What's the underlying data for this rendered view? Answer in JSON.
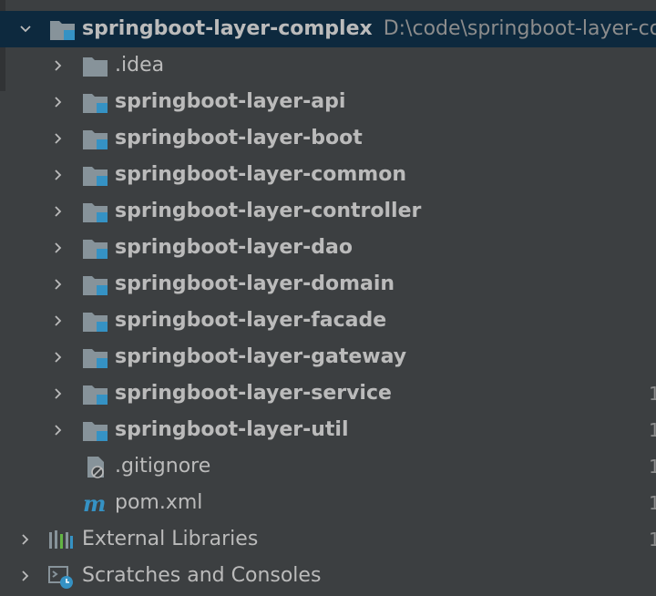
{
  "project": {
    "name": "springboot-layer-complex",
    "path": "D:\\code\\springboot-layer-complex"
  },
  "items": [
    {
      "label": ".idea",
      "kind": "folder"
    },
    {
      "label": "springboot-layer-api",
      "kind": "module"
    },
    {
      "label": "springboot-layer-boot",
      "kind": "module"
    },
    {
      "label": "springboot-layer-common",
      "kind": "module"
    },
    {
      "label": "springboot-layer-controller",
      "kind": "module"
    },
    {
      "label": "springboot-layer-dao",
      "kind": "module"
    },
    {
      "label": "springboot-layer-domain",
      "kind": "module"
    },
    {
      "label": "springboot-layer-facade",
      "kind": "module"
    },
    {
      "label": "springboot-layer-gateway",
      "kind": "module"
    },
    {
      "label": "springboot-layer-service",
      "kind": "module"
    },
    {
      "label": "springboot-layer-util",
      "kind": "module"
    },
    {
      "label": ".gitignore",
      "kind": "ignore-file"
    },
    {
      "label": "pom.xml",
      "kind": "maven-file"
    }
  ],
  "root_nodes": [
    {
      "label": "External Libraries",
      "icon": "libraries-icon"
    },
    {
      "label": "Scratches and Consoles",
      "icon": "scratches-icon"
    }
  ],
  "gutter_digits": [
    "1",
    "1",
    "1",
    "1",
    "1"
  ],
  "colors": {
    "background": "#3c3f41",
    "selection": "#0d293e",
    "text": "#bbbbbb",
    "path": "#8c8c8c",
    "module_badge": "#3592c4",
    "folder": "#87939a"
  }
}
